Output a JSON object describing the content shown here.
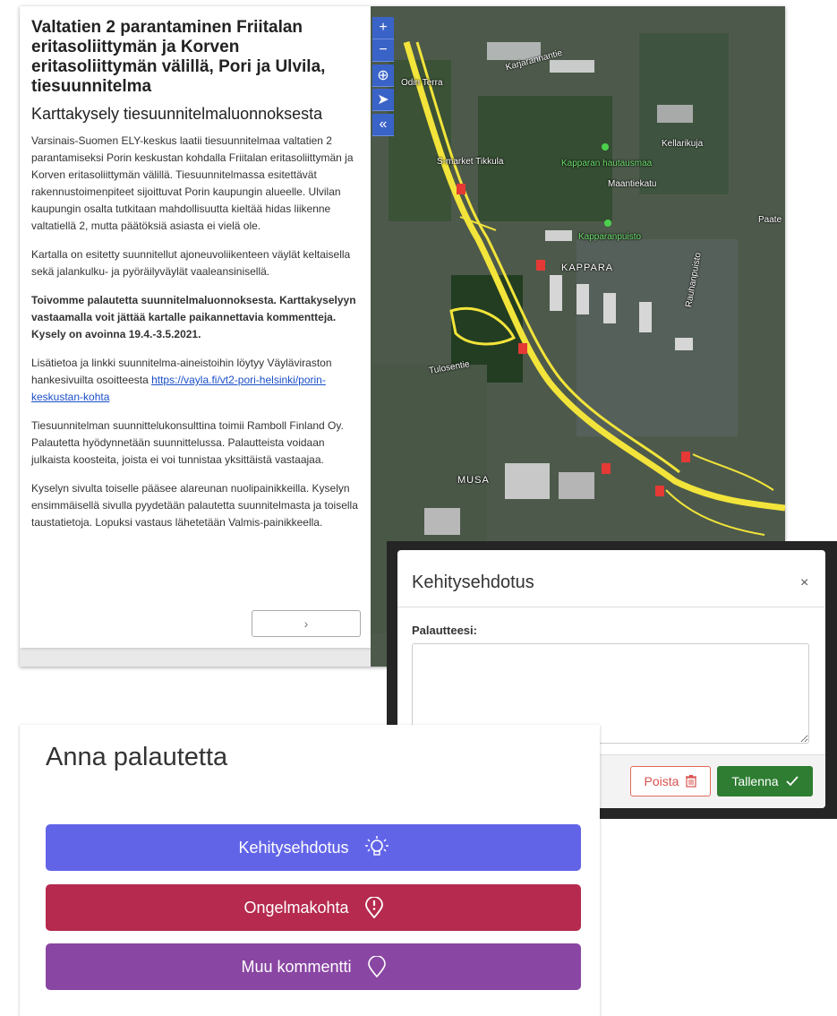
{
  "survey": {
    "title": "Valtatien 2 parantaminen Friitalan eritasoliittymän ja Korven eritasoliittymän välillä, Pori ja Ulvila, tiesuunnitelma",
    "subtitle": "Karttakysely tiesuunnitelmaluonnoksesta",
    "paragraphs": [
      "Varsinais-Suomen ELY-keskus laatii tiesuunnitelmaa valtatien 2 parantamiseksi Porin keskustan kohdalla Friitalan eritasoliittymän ja Korven eritasoliittymän välillä. Tiesuunnitelmassa esitettävät rakennustoimenpiteet sijoittuvat Porin kaupungin alueelle. Ulvilan kaupungin osalta tutkitaan mahdollisuutta kieltää hidas liikenne valtatiellä 2, mutta päätöksiä asiasta ei vielä ole.",
      "Kartalla on esitetty suunnitellut ajoneuvoliikenteen väylät keltaisella sekä jalankulku- ja pyöräilyväylät vaaleansinisellä.",
      "Toivomme palautetta suunnitelmaluonnoksesta. Karttakyselyyn vastaamalla voit jättää kartalle paikannettavia kommentteja. Kysely on avoinna 19.4.-3.5.2021.",
      "Lisätietoa ja linkki suunnitelma-aineistoihin löytyy Väyläviraston hankesivuilta osoitteesta",
      "Tiesuunnitelman suunnittelukonsulttina toimii Ramboll Finland Oy. Palautetta hyödynnetään suunnittelussa. Palautteista voidaan julkaista koosteita, joista ei voi tunnistaa yksittäistä vastaajaa.",
      "Kyselyn sivulta toiselle pääsee alareunan nuolipainikkeilla. Kyselyn ensimmäisellä sivulla pyydetään palautetta suunnitelmasta ja toisella taustatietoja. Lopuksi vastaus lähetetään Valmis-painikkeella."
    ],
    "link_text": "https://vayla.fi/vt2-pori-helsinki/porin-keskustan-kohta",
    "next_label": "›"
  },
  "map": {
    "controls": [
      "+",
      "−",
      "⊕",
      "➤",
      "«"
    ],
    "labels": {
      "karjarannantie": "Karjarannantie",
      "odin_terra": "Odin Terra",
      "kellarikuja": "Kellarikuja",
      "market": "S-market Tikkula",
      "hautausmaa": "Kapparan hautausmaa",
      "maantiekatu": "Maantiekatu",
      "kapparanpuisto": "Kapparanpuisto",
      "kappara": "KAPPARA",
      "tulosentie": "Tulosentie",
      "musa": "MUSA",
      "rauhanpuisto": "Rauhanpuisto",
      "paate": "Paate"
    }
  },
  "dialog": {
    "title": "Kehitysehdotus",
    "close": "×",
    "field_label": "Palautteesi:",
    "textarea_value": "",
    "delete_label": "Poista",
    "save_label": "Tallenna"
  },
  "feedback": {
    "heading": "Anna palautetta",
    "buttons": [
      {
        "label": "Kehitysehdotus",
        "color": "#6264e8",
        "icon": "lightbulb-icon"
      },
      {
        "label": "Ongelmakohta",
        "color": "#b52a4e",
        "icon": "exclamation-pin-icon"
      },
      {
        "label": "Muu kommentti",
        "color": "#8a46a3",
        "icon": "map-pin-icon"
      }
    ]
  },
  "colors": {
    "map_roads": "#f2e43a",
    "map_markers": "#e53935"
  }
}
